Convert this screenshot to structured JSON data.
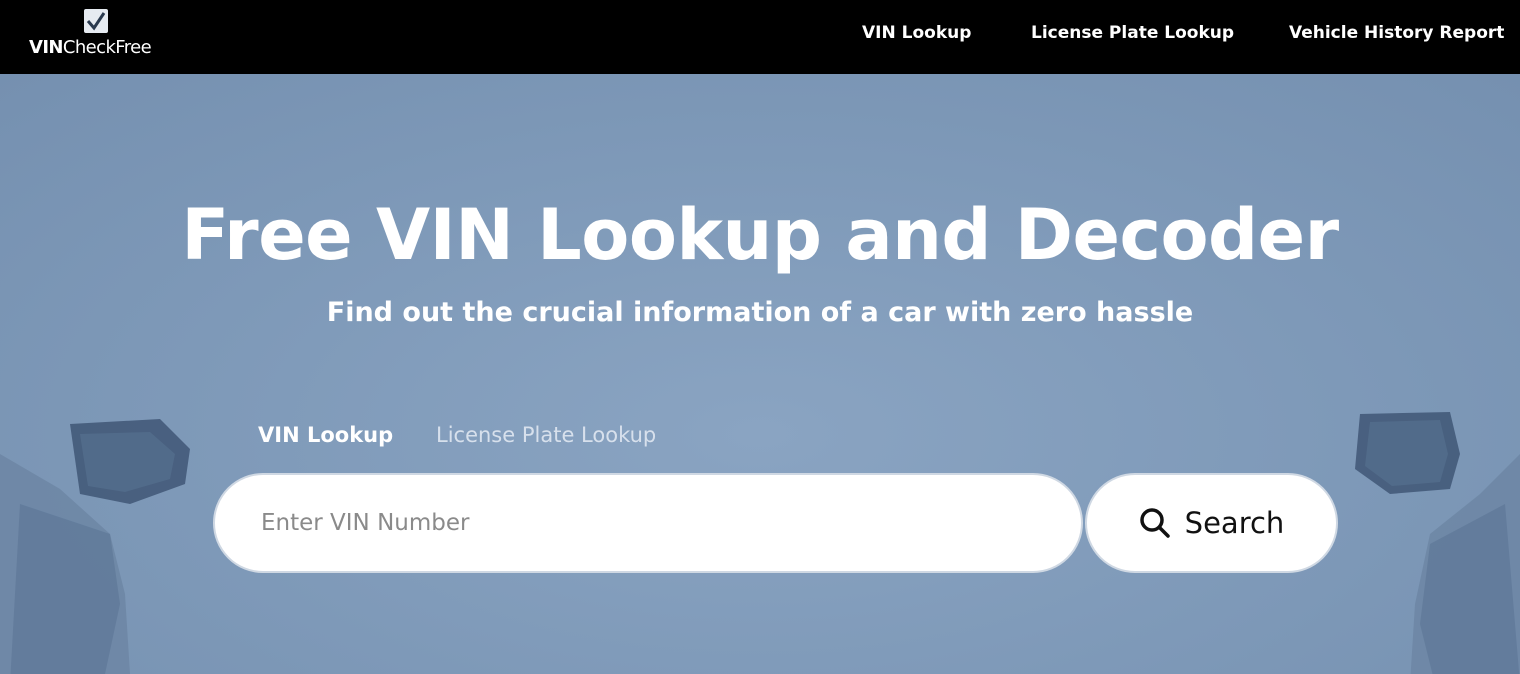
{
  "logo": {
    "bold": "VIN",
    "light": "CheckFree",
    "icon": "checkmark-icon"
  },
  "nav": {
    "vin_lookup": "VIN Lookup",
    "plate_lookup": "License Plate Lookup",
    "history_report": "Vehicle History Report"
  },
  "hero": {
    "title": "Free VIN Lookup and Decoder",
    "subtitle": "Find out the crucial information of a car with zero hassle"
  },
  "tabs": [
    {
      "label": "VIN Lookup",
      "active": true
    },
    {
      "label": "License Plate Lookup",
      "active": false
    }
  ],
  "search": {
    "placeholder": "Enter VIN Number",
    "value": "",
    "button_label": "Search",
    "icon": "search-icon"
  },
  "colors": {
    "navbar": "#000000",
    "hero_bg": "#7f9ab8",
    "text": "#ffffff"
  }
}
